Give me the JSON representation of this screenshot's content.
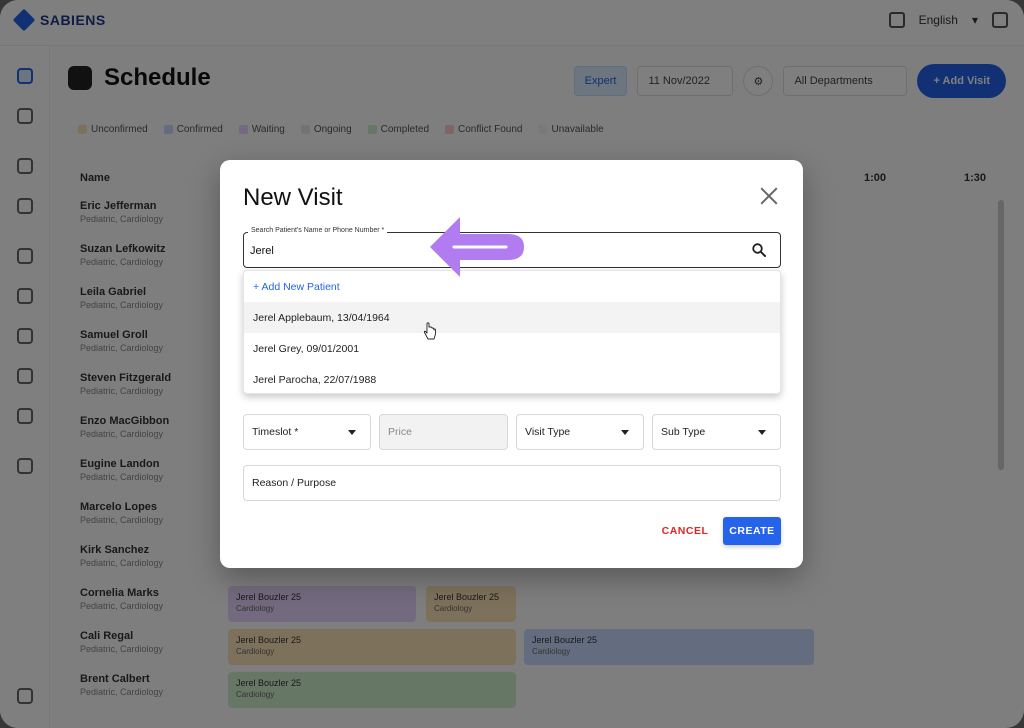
{
  "app": {
    "brand": "SABIENS",
    "language": "English",
    "title": "Schedule",
    "controls": {
      "view": "Expert",
      "date": "11 Nov/2022",
      "departments": "All Departments",
      "add_button": "+ Add Visit"
    },
    "legend": [
      {
        "label": "Unconfirmed",
        "color": "#fde3b8"
      },
      {
        "label": "Confirmed",
        "color": "#c7dbff"
      },
      {
        "label": "Waiting",
        "color": "#e9d5ff"
      },
      {
        "label": "Ongoing",
        "color": "#e5e7eb"
      },
      {
        "label": "Completed",
        "color": "#cdeecb"
      },
      {
        "label": "Conflict Found",
        "color": "#fecaca"
      },
      {
        "label": "Unavailable",
        "color": "#f3f4f6"
      }
    ],
    "grid": {
      "name_header": "Name",
      "col_headers": [
        "1:00",
        "1:30"
      ],
      "rows": [
        {
          "name": "Eric Jefferman",
          "sub": "Pediatric, Cardiology"
        },
        {
          "name": "Suzan Lefkowitz",
          "sub": "Pediatric, Cardiology"
        },
        {
          "name": "Leila Gabriel",
          "sub": "Pediatric, Cardiology"
        },
        {
          "name": "Samuel Groll",
          "sub": "Pediatric, Cardiology"
        },
        {
          "name": "Steven Fitzgerald",
          "sub": "Pediatric, Cardiology"
        },
        {
          "name": "Enzo MacGibbon",
          "sub": "Pediatric, Cardiology"
        },
        {
          "name": "Eugine Landon",
          "sub": "Pediatric, Cardiology"
        },
        {
          "name": "Marcelo Lopes",
          "sub": "Pediatric, Cardiology"
        },
        {
          "name": "Kirk Sanchez",
          "sub": "Pediatric, Cardiology"
        },
        {
          "name": "Cornelia Marks",
          "sub": "Pediatric, Cardiology"
        },
        {
          "name": "Cali Regal",
          "sub": "Pediatric, Cardiology"
        },
        {
          "name": "Brent Calbert",
          "sub": "Pediatric, Cardiology"
        }
      ],
      "appointments": [
        {
          "title": "Jerel Bouzler 25",
          "sub": "Cardiology"
        },
        {
          "title": "Jerel Bouzler 25",
          "sub": "Cardiology"
        },
        {
          "title": "Jerel Bouzler 25",
          "sub": "Cardiology"
        },
        {
          "title": "Jerel Bouzler 25",
          "sub": "Cardiology"
        },
        {
          "title": "Jerel Bouzler 25",
          "sub": "Cardiology"
        }
      ]
    }
  },
  "modal": {
    "title": "New Visit",
    "search": {
      "label": "Search Patient's Name or Phone Number *",
      "value": "Jerel"
    },
    "suggestions": {
      "add_new": "+ Add New Patient",
      "patients": [
        "Jerel Applebaum, 13/04/1964",
        "Jerel Grey, 09/01/2001",
        "Jerel Parocha, 22/07/1988"
      ]
    },
    "fields": {
      "timeslot": "Timeslot *",
      "price": "Price",
      "visit_type": "Visit Type",
      "sub_type": "Sub Type",
      "reason": "Reason / Purpose"
    },
    "actions": {
      "cancel": "CANCEL",
      "create": "CREATE"
    }
  },
  "annotation": {
    "arrow_color": "#b07cf0"
  }
}
